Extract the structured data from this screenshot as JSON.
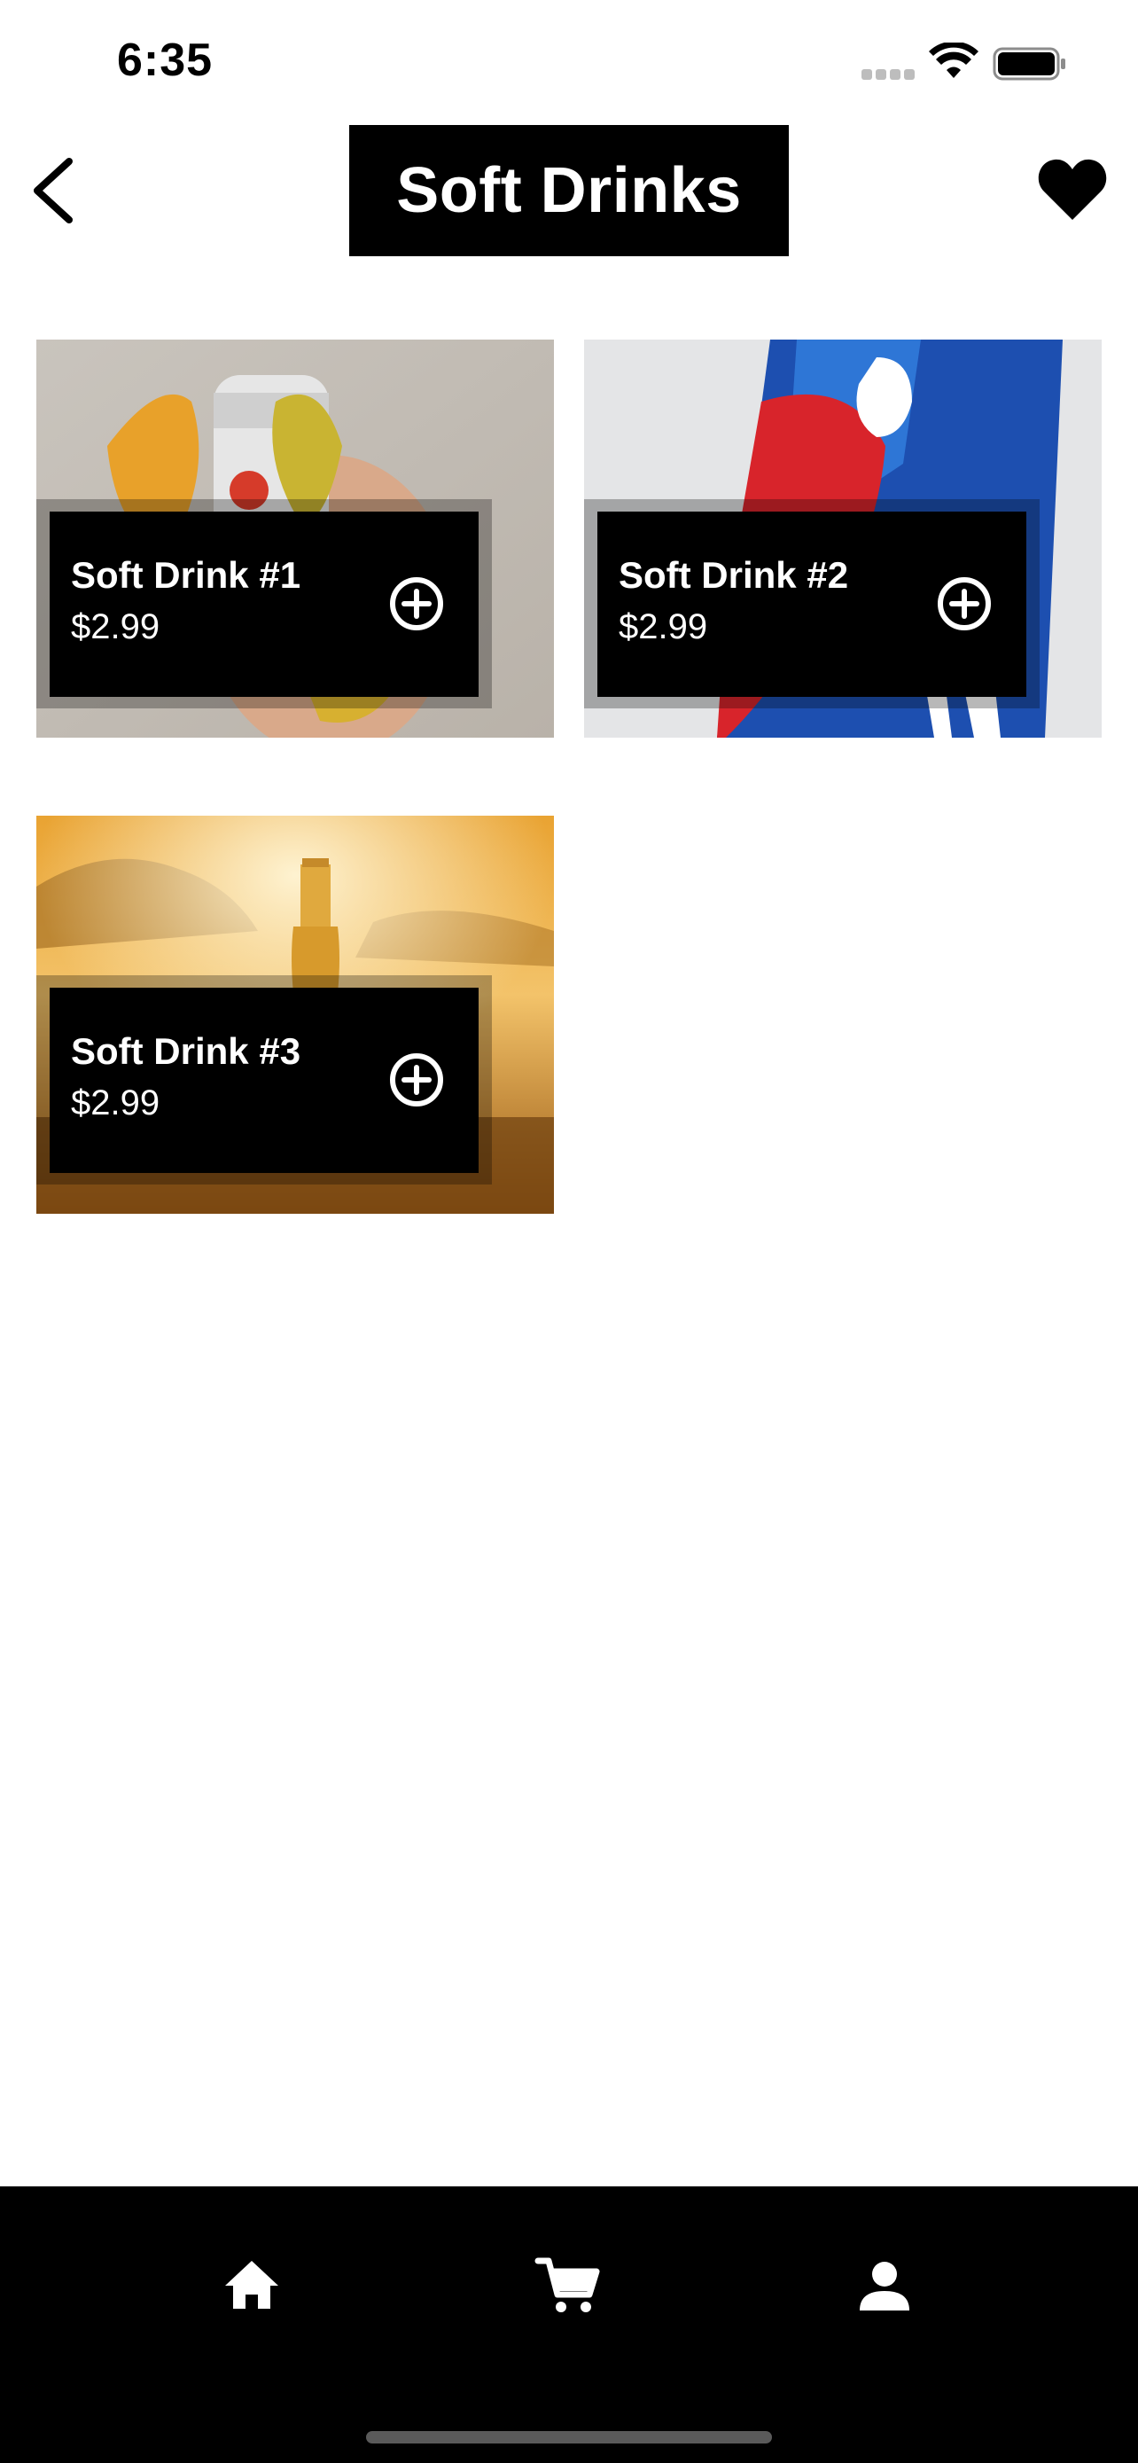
{
  "status_bar": {
    "time": "6:35",
    "icons": [
      "signal-icon",
      "wifi-icon",
      "battery-icon"
    ]
  },
  "header": {
    "title": "Soft Drinks",
    "back_icon": "chevron-left-icon",
    "favorite_icon": "heart-icon"
  },
  "products": [
    {
      "name": "Soft Drink #1",
      "price": "$2.99",
      "add_icon": "plus-circle-icon"
    },
    {
      "name": "Soft Drink #2",
      "price": "$2.99",
      "add_icon": "plus-circle-icon"
    },
    {
      "name": "Soft Drink #3",
      "price": "$2.99",
      "add_icon": "plus-circle-icon"
    }
  ],
  "tab_bar": {
    "items": [
      {
        "icon": "home-icon"
      },
      {
        "icon": "cart-icon"
      },
      {
        "icon": "person-icon"
      }
    ]
  },
  "colors": {
    "background": "#ffffff",
    "panel": "#000000",
    "text_on_panel": "#ffffff",
    "tab_bar": "#000000"
  }
}
